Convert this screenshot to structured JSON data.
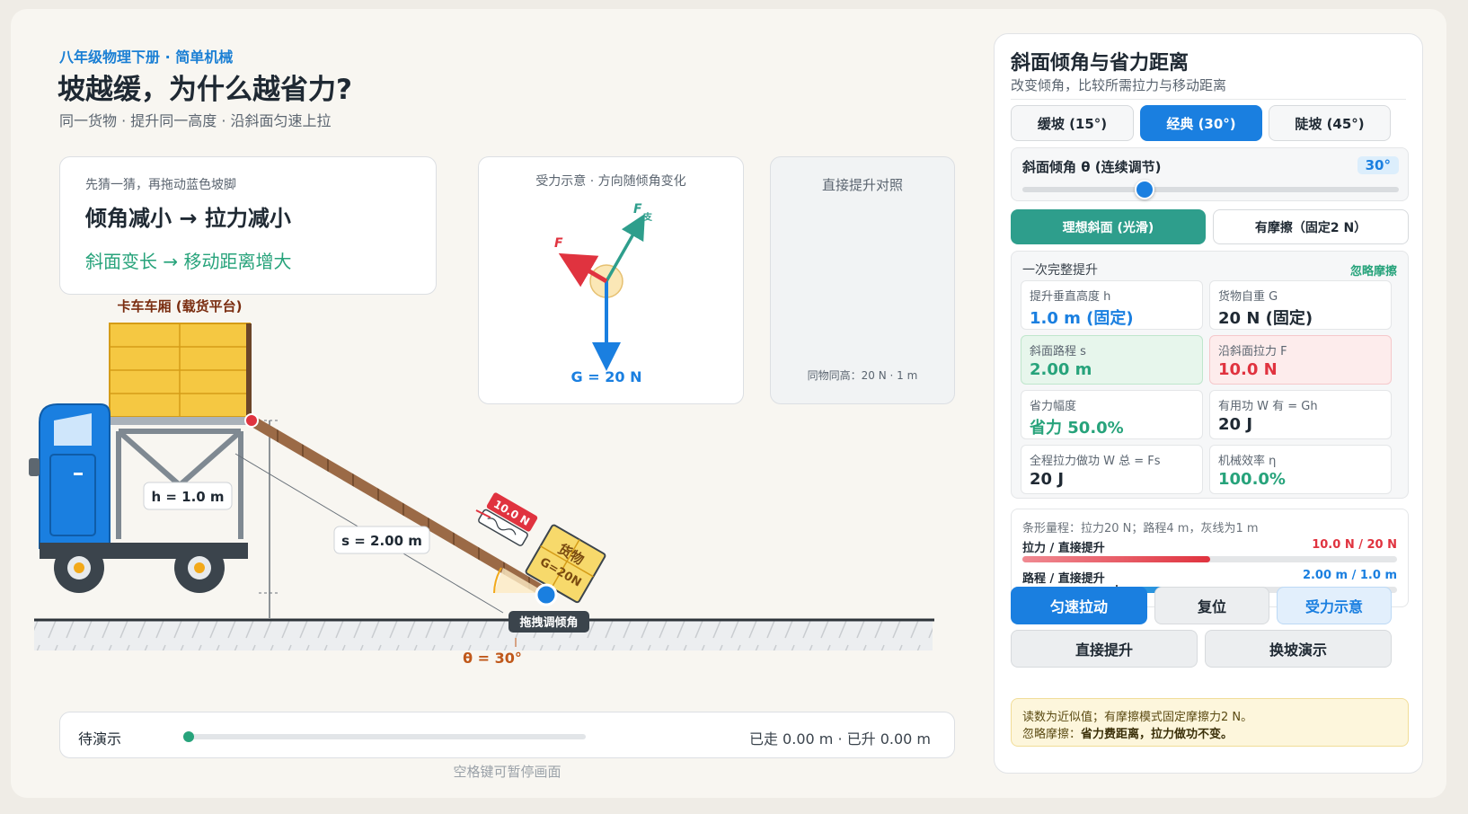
{
  "header": {
    "kicker": "八年级物理下册 · 简单机械",
    "title": "坡越缓，为什么越省力?",
    "subtitle": "同一货物 · 提升同一高度 · 沿斜面匀速上拉"
  },
  "guess": {
    "hint": "先猜一猜，再拖动蓝色坡脚",
    "main": "倾角减小 → 拉力减小",
    "sub": "斜面变长 → 移动距离增大"
  },
  "force_diagram": {
    "title": "受力示意 · 方向随倾角变化",
    "label_F": "F",
    "label_N": "F",
    "label_N_sub": "支",
    "label_G": "G = 20 N"
  },
  "compare": {
    "title": "直接提升对照",
    "note": "同物同高：20 N · 1 m"
  },
  "scene": {
    "truck_label": "卡车车厢 (载货平台)",
    "height_label": "h = 1.0 m",
    "length_label": "s = 2.00 m",
    "force_tag": "10.0 N",
    "cargo_name": "货物",
    "cargo_weight": "G=20N",
    "handle_label": "拖拽调倾角",
    "angle_label": "θ = 30°",
    "angle_deg": 30
  },
  "progress": {
    "state": "待演示",
    "readout": "已走 0.00 m · 已升 0.00 m",
    "fraction": 0,
    "hint": "空格键可暂停画面"
  },
  "panel": {
    "title": "斜面倾角与省力距离",
    "subtitle": "改变倾角，比较所需拉力与移动距离",
    "presets": [
      {
        "label": "缓坡 (15°)",
        "active": false
      },
      {
        "label": "经典 (30°)",
        "active": true
      },
      {
        "label": "陡坡 (45°)",
        "active": false
      }
    ],
    "slider": {
      "label": "斜面倾角 θ (连续调节)",
      "value_text": "30°",
      "value": 30
    },
    "modes": {
      "ideal": "理想斜面 (光滑)",
      "friction": "有摩擦（固定2 N）"
    },
    "metrics": {
      "heading": "一次完整提升",
      "tag": "忽略摩擦",
      "cells": {
        "h": {
          "label": "提升垂直高度 h",
          "value": "1.0 m (固定)"
        },
        "G": {
          "label": "货物自重 G",
          "value": "20 N (固定)"
        },
        "s": {
          "label": "斜面路程 s",
          "value": "2.00 m"
        },
        "F": {
          "label": "沿斜面拉力 F",
          "value": "10.0 N"
        },
        "save": {
          "label": "省力幅度",
          "value": "省力 50.0%"
        },
        "Wu": {
          "label": "有用功 W 有 = Gh",
          "value": "20 J"
        },
        "Wt": {
          "label": "全程拉力做功 W 总 = Fs",
          "value": "20 J"
        },
        "eta": {
          "label": "机械效率 η",
          "value": "100.0%"
        }
      }
    },
    "bars": {
      "note": "条形量程：拉力20 N；路程4 m，灰线为1 m",
      "force_label": "拉力 / 直接提升",
      "force_value": "10.0 N / 20 N",
      "force_fraction": 0.5,
      "distance_label": "路程 / 直接提升",
      "distance_value": "2.00 m / 1.0 m",
      "distance_fraction": 0.5,
      "distance_ref_fraction": 0.25,
      "force_color": "#e0333f",
      "distance_color": "#1a7fe0"
    },
    "buttons": {
      "pull": "匀速拉动",
      "reset": "复位",
      "forces": "受力示意",
      "direct": "直接提升",
      "swap": "换坡演示"
    },
    "notice": {
      "line1": "读数为近似值；有摩擦模式固定摩擦力2 N。",
      "line2_prefix": "忽略摩擦：",
      "line2_bold": "省力费距离，拉力做功不变。"
    }
  },
  "colors": {
    "accent": "#1a7fe0",
    "teal": "#2e9e8c",
    "green": "#27a37b",
    "red": "#e0333f",
    "angle_orange": "#c0581a"
  }
}
